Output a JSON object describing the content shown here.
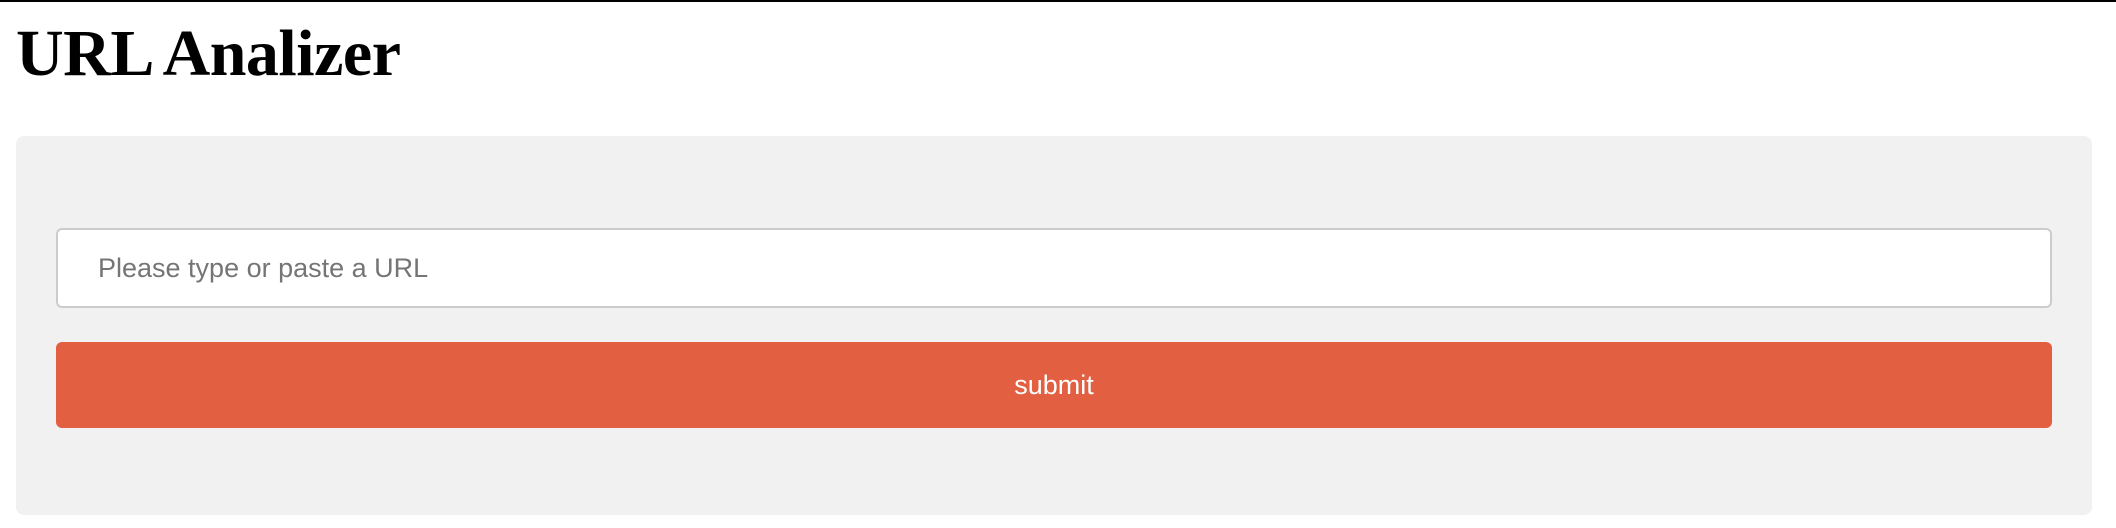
{
  "header": {
    "title": "URL Analizer"
  },
  "form": {
    "url_input": {
      "value": "",
      "placeholder": "Please type or paste a URL"
    },
    "submit_label": "submit"
  },
  "colors": {
    "panel_background": "#f1f1f1",
    "submit_background": "#e35f42",
    "submit_text": "#ffffff",
    "input_border": "#cccccc"
  }
}
